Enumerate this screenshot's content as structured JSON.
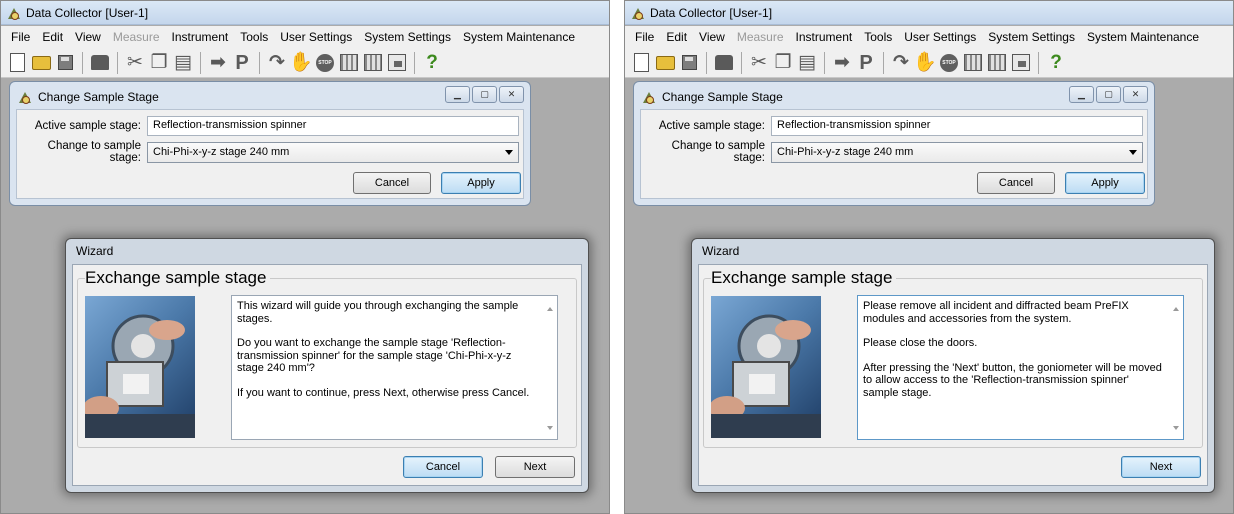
{
  "app": {
    "title": "Data Collector [User-1]",
    "menu": [
      "File",
      "Edit",
      "View",
      "Measure",
      "Instrument",
      "Tools",
      "User Settings",
      "System Settings",
      "System Maintenance"
    ],
    "disabled_menu": "Measure"
  },
  "toolbar": {
    "icons": [
      "new-document-icon",
      "open-folder-icon",
      "save-icon",
      "drive-icon",
      "cut-icon",
      "copy-icon",
      "paste-icon",
      "arrow-right-icon",
      "p-icon",
      "redo-icon",
      "hand-icon",
      "stop-icon",
      "grid-icon",
      "grid-alt-icon",
      "chart-icon",
      "help-icon"
    ]
  },
  "change_sample_stage": {
    "title": "Change Sample Stage",
    "active_label": "Active sample stage:",
    "active_value": "Reflection-transmission spinner",
    "change_label": "Change to sample stage:",
    "change_value": "Chi-Phi-x-y-z stage 240 mm",
    "cancel": "Cancel",
    "apply": "Apply"
  },
  "wizard_left": {
    "title": "Wizard",
    "heading": "Exchange sample stage",
    "paragraphs": [
      "This wizard will guide you through exchanging the sample stages.",
      "Do you want to exchange the sample stage 'Reflection-transmission spinner' for the sample stage 'Chi-Phi-x-y-z stage 240 mm'?",
      "If you want to continue, press Next, otherwise press Cancel."
    ],
    "cancel": "Cancel",
    "next": "Next"
  },
  "wizard_right": {
    "title": "Wizard",
    "heading": "Exchange sample stage",
    "paragraphs": [
      "Please remove all incident and diffracted beam PreFIX modules and accessories from the system.",
      "Please close the doors.",
      "After pressing the 'Next' button, the goniometer will be moved to allow access to the 'Reflection-transmission spinner' sample stage."
    ],
    "next": "Next"
  },
  "colors": {
    "workspace": "#ababab",
    "dialog_frame": "#dae4f0",
    "accent": "#3c7fb1"
  }
}
